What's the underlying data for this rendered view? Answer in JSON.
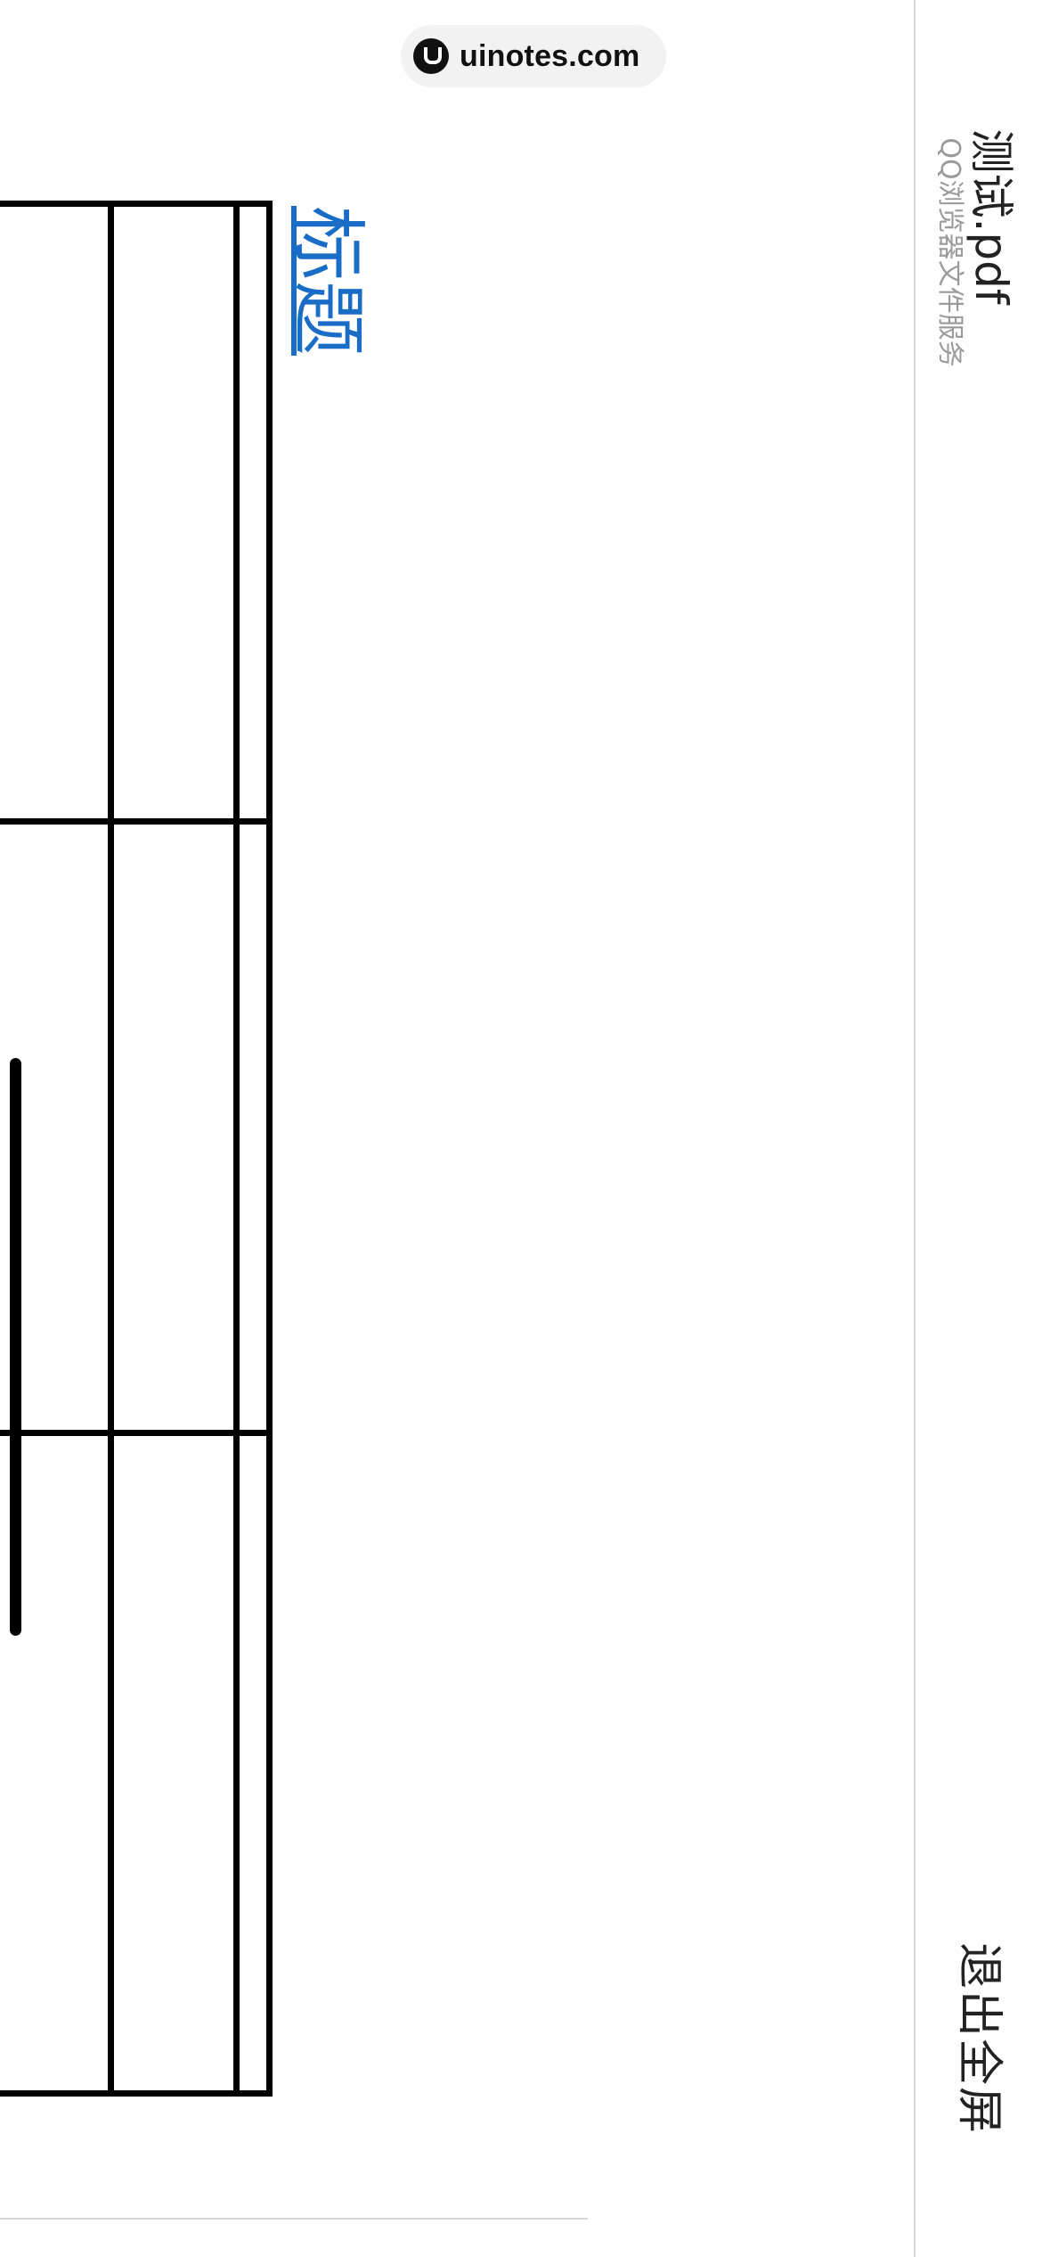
{
  "watermark": {
    "text": "uinotes.com",
    "icon": "uinotes-logo-icon"
  },
  "document": {
    "heading": "标题"
  },
  "sidebar": {
    "file_title": "测试.pdf",
    "service_label": "QQ浏览器文件服务",
    "exit_fullscreen_label": "退出全屏"
  },
  "colors": {
    "heading": "#1a6dc7",
    "table_border": "#000000",
    "sidebar_border": "#d8d8d8",
    "subtitle": "#9a9a9a"
  }
}
